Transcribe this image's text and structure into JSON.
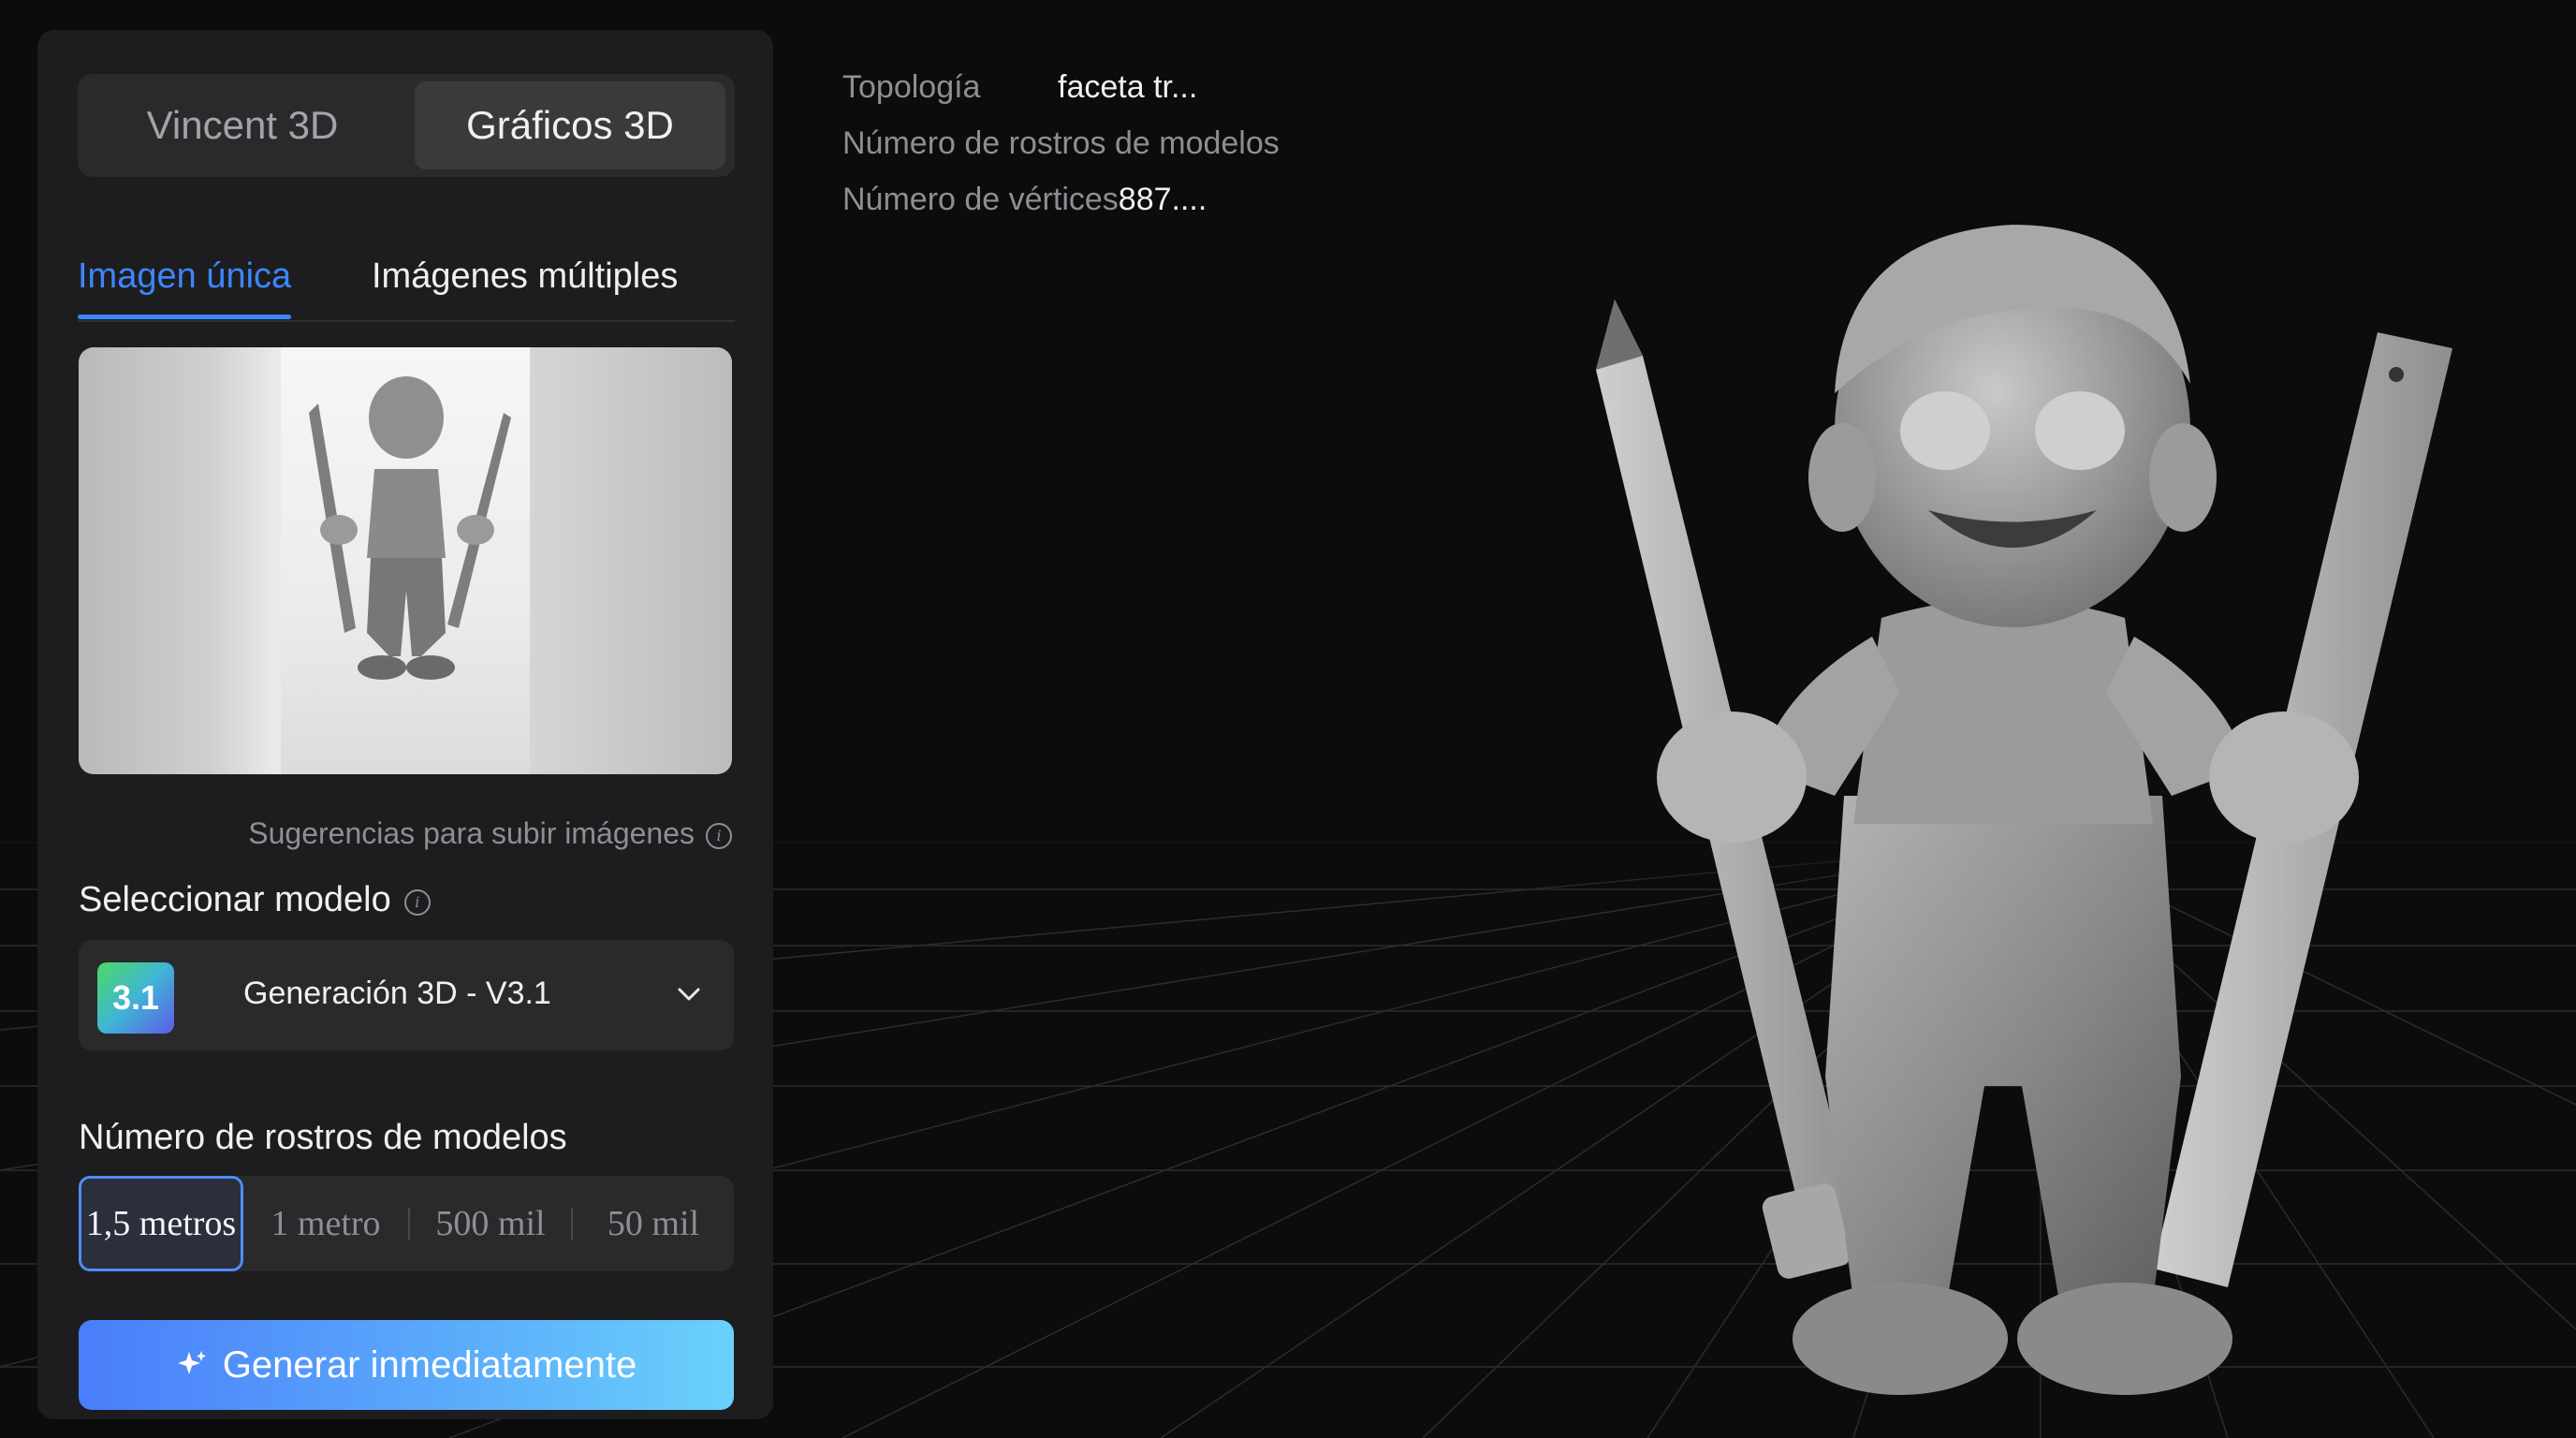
{
  "mode_switch": {
    "left_label": "Vincent 3D",
    "right_label": "Gráficos 3D",
    "selected": "Gráficos 3D"
  },
  "input_tabs": {
    "active": "Imagen única",
    "inactive": "Imágenes múltiples"
  },
  "upload": {
    "hint": "Sugerencias para subir imágenes"
  },
  "model": {
    "section_label": "Seleccionar modelo",
    "badge": "3.1",
    "name": "Generación 3D - V3.1"
  },
  "faces": {
    "section_label": "Número de rostros de modelos",
    "options": [
      "1,5 metros",
      "1 metro",
      "500 mil",
      "50 mil"
    ],
    "selected": "1,5 metros"
  },
  "generate": {
    "label": "Generar inmediatamente"
  },
  "model_info": {
    "topology_label": "Topología",
    "topology_value": "faceta tr...",
    "faces_label": "Número de rostros de modelos",
    "vertices_label": "Número de vértices",
    "vertices_value": "887...."
  },
  "colors": {
    "accent": "#3d86ff",
    "panel": "#1d1d1f",
    "background": "#0c0c0d"
  }
}
